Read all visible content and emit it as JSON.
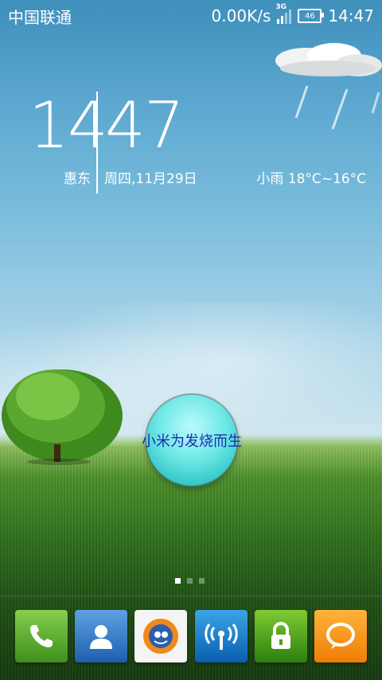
{
  "status_bar": {
    "carrier": "中国联通",
    "net_speed": "0.00K/s",
    "network_type": "3G",
    "battery_level": "46",
    "time": "14:47"
  },
  "clock_widget": {
    "hour": "14",
    "minute": "47",
    "city": "惠东",
    "date": "周四,11月29日"
  },
  "weather_widget": {
    "condition_icon": "cloud-rain-icon",
    "summary": "小雨 18°C~16°C"
  },
  "floating_ball": {
    "label": "小米为发烧而生"
  },
  "page_indicator": {
    "total": 3,
    "active_index": 0
  },
  "dock": {
    "apps": [
      {
        "name": "phone",
        "icon": "phone-icon",
        "color": "#4ea82a"
      },
      {
        "name": "contacts",
        "icon": "contacts-icon",
        "color": "#2f78c8"
      },
      {
        "name": "uc-browser",
        "icon": "uc-browser-icon",
        "color": "#f07c12"
      },
      {
        "name": "wifi-key",
        "icon": "wifi-icon",
        "color": "#1576c9"
      },
      {
        "name": "lock-screen",
        "icon": "lock-icon",
        "color": "#4f9e1c"
      },
      {
        "name": "messages",
        "icon": "message-icon",
        "color": "#f39214"
      }
    ]
  }
}
